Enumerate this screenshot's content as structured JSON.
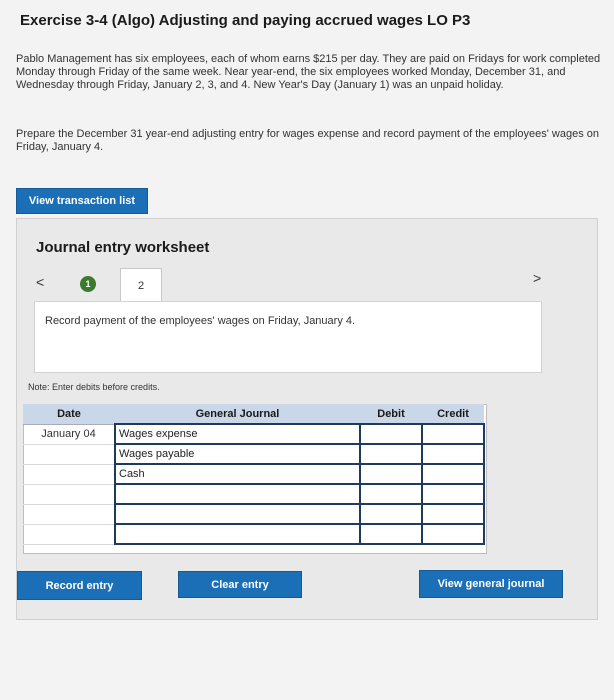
{
  "title": "Exercise 3-4 (Algo) Adjusting and paying accrued wages LO P3",
  "paragraph1": "Pablo Management has six employees, each of whom earns $215 per day. They are paid on Fridays for work completed Monday through Friday of the same week. Near year-end, the six employees worked Monday, December 31, and Wednesday through Friday, January 2, 3, and 4. New Year's Day (January 1) was an unpaid holiday.",
  "paragraph2": "Prepare the December 31 year-end adjusting entry for wages expense and record payment of the employees' wages on Friday, January 4.",
  "buttons": {
    "view_transaction_list": "View transaction list",
    "record_entry": "Record entry",
    "clear_entry": "Clear entry",
    "view_general_journal": "View general journal"
  },
  "worksheet": {
    "title": "Journal entry worksheet",
    "nav_prev": "<",
    "nav_next": ">",
    "steps": [
      "1",
      "2"
    ],
    "current_step": "2",
    "instruction": "Record payment of the employees' wages on Friday, January 4.",
    "note": "Note: Enter debits before credits."
  },
  "journal": {
    "headers": {
      "date": "Date",
      "account": "General Journal",
      "debit": "Debit",
      "credit": "Credit"
    },
    "rows": [
      {
        "date": "January 04",
        "account": "Wages expense",
        "debit": "",
        "credit": ""
      },
      {
        "date": "",
        "account": "Wages payable",
        "debit": "",
        "credit": ""
      },
      {
        "date": "",
        "account": "Cash",
        "debit": "",
        "credit": ""
      },
      {
        "date": "",
        "account": "",
        "debit": "",
        "credit": ""
      },
      {
        "date": "",
        "account": "",
        "debit": "",
        "credit": ""
      },
      {
        "date": "",
        "account": "",
        "debit": "",
        "credit": ""
      }
    ]
  },
  "colors": {
    "primary_button": "#1a6fb7",
    "step_complete": "#3d7a2e",
    "header_bg": "#c9d7e8"
  }
}
